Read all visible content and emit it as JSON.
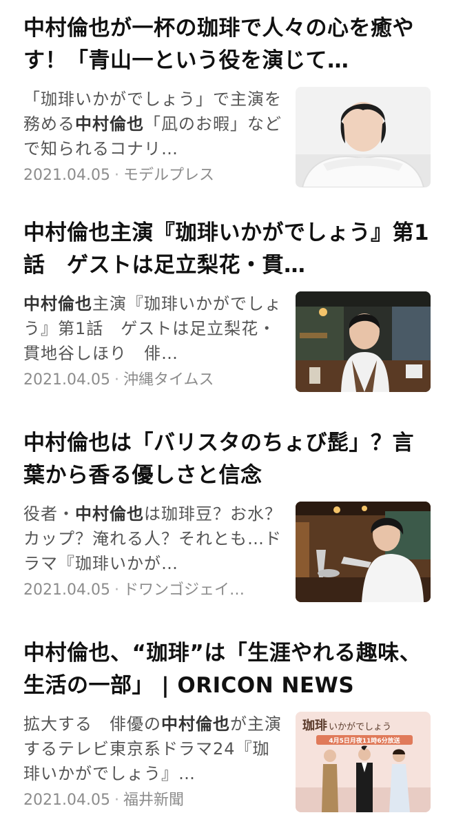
{
  "articles": [
    {
      "headline": "中村倫也が一杯の珈琲で人々の心を癒やす！「青山一という役を演じて…",
      "snippet_pre": "「珈琲いかがでしょう」で主演を務める",
      "snippet_bold": "中村倫也",
      "snippet_post": "「凪のお暇」などで知られるコナリ…",
      "date": "2021.04.05",
      "source": "モデルプレス",
      "thumbnail_icon": "portrait-photo"
    },
    {
      "headline": "中村倫也主演『珈琲いかがでしょう』第1話　ゲストは足立梨花・貫…",
      "snippet_pre": "",
      "snippet_bold": "中村倫也",
      "snippet_post": "主演『珈琲いかがでしょう』第1話　ゲストは足立梨花・貫地谷しほり　俳…",
      "date": "2021.04.05",
      "source": "沖縄タイムス",
      "thumbnail_icon": "barista-photo"
    },
    {
      "headline": "中村倫也は「バリスタのちょび髭」？言葉から香る優しさと信念",
      "snippet_pre": "役者・",
      "snippet_bold": "中村倫也",
      "snippet_post": "は珈琲豆？お水？カップ？淹れる人？それとも…ドラマ『珈琲いかが…",
      "date": "2021.04.05",
      "source": "ドワンゴジェイ…",
      "thumbnail_icon": "coffee-pour-photo"
    },
    {
      "headline": "中村倫也、“珈琲”は「生涯やれる趣味、生活の一部」 | ORICON NEWS",
      "snippet_pre": "拡大する　俳優の",
      "snippet_bold": "中村倫也",
      "snippet_post": "が主演するテレビ東京系ドラマ24『珈琲いかがでしょう』…",
      "date": "2021.04.05",
      "source": "福井新聞",
      "thumbnail_icon": "cast-event-photo",
      "thumbnail_text": {
        "title_a": "珈琲",
        "title_b": "いかがでしょう",
        "broadcast": "4月5日月夜11時6分放送"
      }
    }
  ],
  "colors": {
    "headline": "#111111",
    "snippet": "#555555",
    "meta": "#8c8c8c",
    "background": "#ffffff"
  }
}
